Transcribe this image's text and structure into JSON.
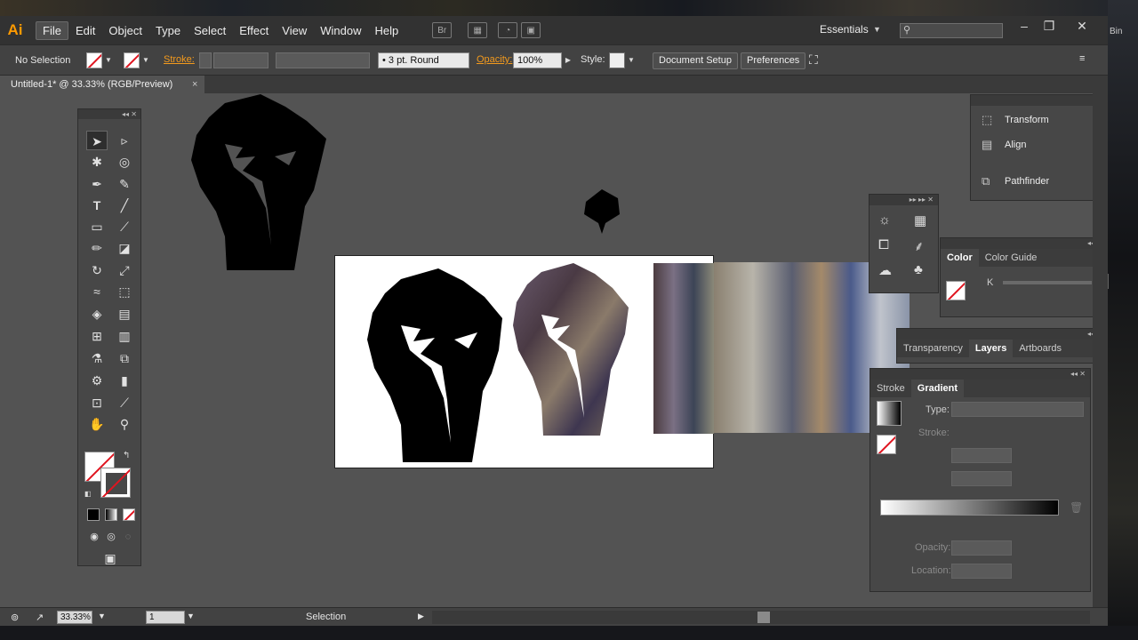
{
  "menubar": {
    "logo": "Ai",
    "menus": [
      "File",
      "Edit",
      "Object",
      "Type",
      "Select",
      "Effect",
      "View",
      "Window",
      "Help"
    ],
    "br_icon": "Br",
    "workspace": "Essentials",
    "search_placeholder": ""
  },
  "control": {
    "selection": "No Selection",
    "stroke_label": "Stroke:",
    "brush": "3 pt. Round",
    "opacity_label": "Opacity:",
    "opacity_value": "100%",
    "style_label": "Style:",
    "document_setup": "Document Setup",
    "preferences": "Preferences"
  },
  "document": {
    "tab_title": "Untitled-1* @ 33.33% (RGB/Preview)",
    "close": "×"
  },
  "right_top_panel": {
    "items": [
      "Transform",
      "Align",
      "Pathfinder"
    ]
  },
  "color_panel": {
    "tabs": [
      "Color",
      "Color Guide"
    ],
    "k_label": "K",
    "k_value": "",
    "pct": "%"
  },
  "layers_panel": {
    "tabs": [
      "Transparency",
      "Layers",
      "Artboards"
    ]
  },
  "gradient_panel": {
    "tabs": [
      "Stroke",
      "Gradient"
    ],
    "type_label": "Type:",
    "stroke_label": "Stroke:",
    "opacity_label": "Opacity:",
    "location_label": "Location:"
  },
  "status": {
    "zoom": "33.33%",
    "artboard": "1",
    "tool": "Selection"
  },
  "desktop": {
    "label": "Bin"
  }
}
